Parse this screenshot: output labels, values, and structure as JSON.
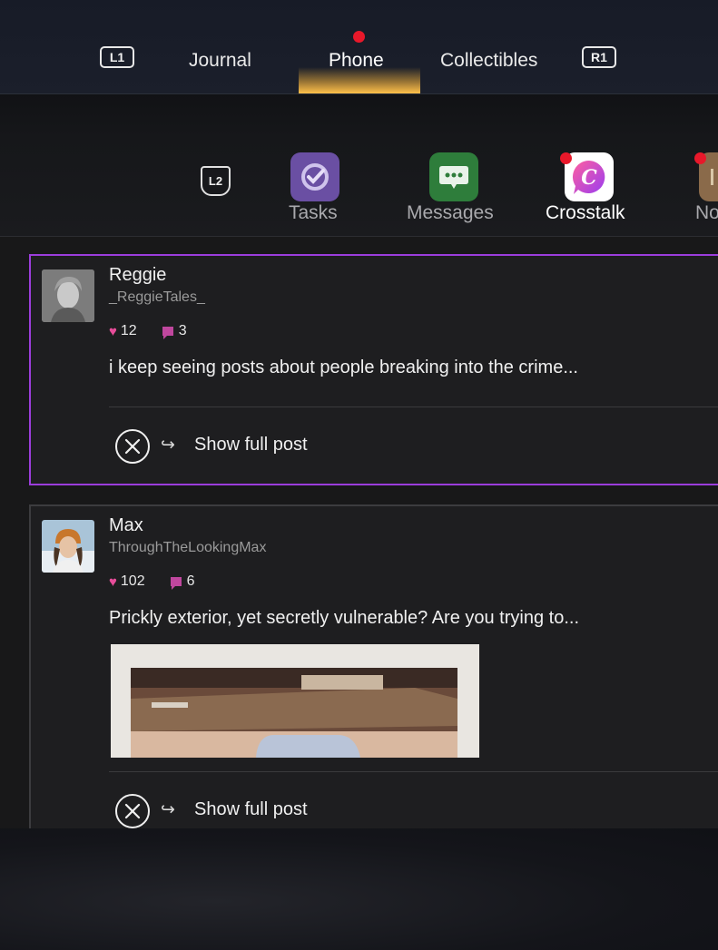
{
  "top_nav": {
    "left_button": "L1",
    "right_button": "R1",
    "tabs": [
      {
        "label": "Journal",
        "active": false
      },
      {
        "label": "Phone",
        "active": true,
        "notification": true
      },
      {
        "label": "Collectibles",
        "active": false
      }
    ]
  },
  "app_bar": {
    "left_button": "L2",
    "apps": [
      {
        "label": "Tasks",
        "icon": "check-circle-icon",
        "color": "#6a4fa3",
        "notification": false
      },
      {
        "label": "Messages",
        "icon": "chat-bubble-icon",
        "color": "#2e7d3b",
        "notification": false
      },
      {
        "label": "Crosstalk",
        "icon": "crosstalk-logo-icon",
        "color": "#ffffff",
        "notification": true,
        "selected": true
      },
      {
        "label": "No",
        "icon": "notes-icon",
        "color": "#8a6a4a",
        "notification": true
      }
    ]
  },
  "posts": [
    {
      "name": "Reggie",
      "handle": "_ReggieTales_",
      "likes": "12",
      "comments": "3",
      "text": "i keep seeing posts about people breaking into the crime...",
      "action": "Show full post",
      "selected": true
    },
    {
      "name": "Max",
      "handle": "ThroughTheLookingMax",
      "likes": "102",
      "comments": "6",
      "text": "Prickly exterior, yet secretly vulnerable? Are you trying to...",
      "action": "Show full post",
      "selected": false,
      "has_image": true
    }
  ],
  "colors": {
    "accent_purple": "#9b3ddb",
    "notification_red": "#e8182a",
    "tab_glow": "#ffc04a",
    "heart_pink": "#e84d9a"
  }
}
